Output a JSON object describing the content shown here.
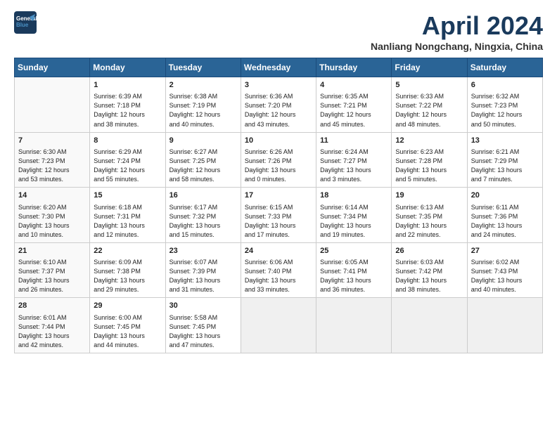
{
  "header": {
    "logo_line1": "General",
    "logo_line2": "Blue",
    "month": "April 2024",
    "location": "Nanliang Nongchang, Ningxia, China"
  },
  "weekdays": [
    "Sunday",
    "Monday",
    "Tuesday",
    "Wednesday",
    "Thursday",
    "Friday",
    "Saturday"
  ],
  "weeks": [
    [
      {
        "day": null,
        "content": null
      },
      {
        "day": "1",
        "content": "Sunrise: 6:39 AM\nSunset: 7:18 PM\nDaylight: 12 hours\nand 38 minutes."
      },
      {
        "day": "2",
        "content": "Sunrise: 6:38 AM\nSunset: 7:19 PM\nDaylight: 12 hours\nand 40 minutes."
      },
      {
        "day": "3",
        "content": "Sunrise: 6:36 AM\nSunset: 7:20 PM\nDaylight: 12 hours\nand 43 minutes."
      },
      {
        "day": "4",
        "content": "Sunrise: 6:35 AM\nSunset: 7:21 PM\nDaylight: 12 hours\nand 45 minutes."
      },
      {
        "day": "5",
        "content": "Sunrise: 6:33 AM\nSunset: 7:22 PM\nDaylight: 12 hours\nand 48 minutes."
      },
      {
        "day": "6",
        "content": "Sunrise: 6:32 AM\nSunset: 7:23 PM\nDaylight: 12 hours\nand 50 minutes."
      }
    ],
    [
      {
        "day": "7",
        "content": "Sunrise: 6:30 AM\nSunset: 7:23 PM\nDaylight: 12 hours\nand 53 minutes."
      },
      {
        "day": "8",
        "content": "Sunrise: 6:29 AM\nSunset: 7:24 PM\nDaylight: 12 hours\nand 55 minutes."
      },
      {
        "day": "9",
        "content": "Sunrise: 6:27 AM\nSunset: 7:25 PM\nDaylight: 12 hours\nand 58 minutes."
      },
      {
        "day": "10",
        "content": "Sunrise: 6:26 AM\nSunset: 7:26 PM\nDaylight: 13 hours\nand 0 minutes."
      },
      {
        "day": "11",
        "content": "Sunrise: 6:24 AM\nSunset: 7:27 PM\nDaylight: 13 hours\nand 3 minutes."
      },
      {
        "day": "12",
        "content": "Sunrise: 6:23 AM\nSunset: 7:28 PM\nDaylight: 13 hours\nand 5 minutes."
      },
      {
        "day": "13",
        "content": "Sunrise: 6:21 AM\nSunset: 7:29 PM\nDaylight: 13 hours\nand 7 minutes."
      }
    ],
    [
      {
        "day": "14",
        "content": "Sunrise: 6:20 AM\nSunset: 7:30 PM\nDaylight: 13 hours\nand 10 minutes."
      },
      {
        "day": "15",
        "content": "Sunrise: 6:18 AM\nSunset: 7:31 PM\nDaylight: 13 hours\nand 12 minutes."
      },
      {
        "day": "16",
        "content": "Sunrise: 6:17 AM\nSunset: 7:32 PM\nDaylight: 13 hours\nand 15 minutes."
      },
      {
        "day": "17",
        "content": "Sunrise: 6:15 AM\nSunset: 7:33 PM\nDaylight: 13 hours\nand 17 minutes."
      },
      {
        "day": "18",
        "content": "Sunrise: 6:14 AM\nSunset: 7:34 PM\nDaylight: 13 hours\nand 19 minutes."
      },
      {
        "day": "19",
        "content": "Sunrise: 6:13 AM\nSunset: 7:35 PM\nDaylight: 13 hours\nand 22 minutes."
      },
      {
        "day": "20",
        "content": "Sunrise: 6:11 AM\nSunset: 7:36 PM\nDaylight: 13 hours\nand 24 minutes."
      }
    ],
    [
      {
        "day": "21",
        "content": "Sunrise: 6:10 AM\nSunset: 7:37 PM\nDaylight: 13 hours\nand 26 minutes."
      },
      {
        "day": "22",
        "content": "Sunrise: 6:09 AM\nSunset: 7:38 PM\nDaylight: 13 hours\nand 29 minutes."
      },
      {
        "day": "23",
        "content": "Sunrise: 6:07 AM\nSunset: 7:39 PM\nDaylight: 13 hours\nand 31 minutes."
      },
      {
        "day": "24",
        "content": "Sunrise: 6:06 AM\nSunset: 7:40 PM\nDaylight: 13 hours\nand 33 minutes."
      },
      {
        "day": "25",
        "content": "Sunrise: 6:05 AM\nSunset: 7:41 PM\nDaylight: 13 hours\nand 36 minutes."
      },
      {
        "day": "26",
        "content": "Sunrise: 6:03 AM\nSunset: 7:42 PM\nDaylight: 13 hours\nand 38 minutes."
      },
      {
        "day": "27",
        "content": "Sunrise: 6:02 AM\nSunset: 7:43 PM\nDaylight: 13 hours\nand 40 minutes."
      }
    ],
    [
      {
        "day": "28",
        "content": "Sunrise: 6:01 AM\nSunset: 7:44 PM\nDaylight: 13 hours\nand 42 minutes."
      },
      {
        "day": "29",
        "content": "Sunrise: 6:00 AM\nSunset: 7:45 PM\nDaylight: 13 hours\nand 44 minutes."
      },
      {
        "day": "30",
        "content": "Sunrise: 5:58 AM\nSunset: 7:45 PM\nDaylight: 13 hours\nand 47 minutes."
      },
      {
        "day": null,
        "content": null
      },
      {
        "day": null,
        "content": null
      },
      {
        "day": null,
        "content": null
      },
      {
        "day": null,
        "content": null
      }
    ]
  ]
}
